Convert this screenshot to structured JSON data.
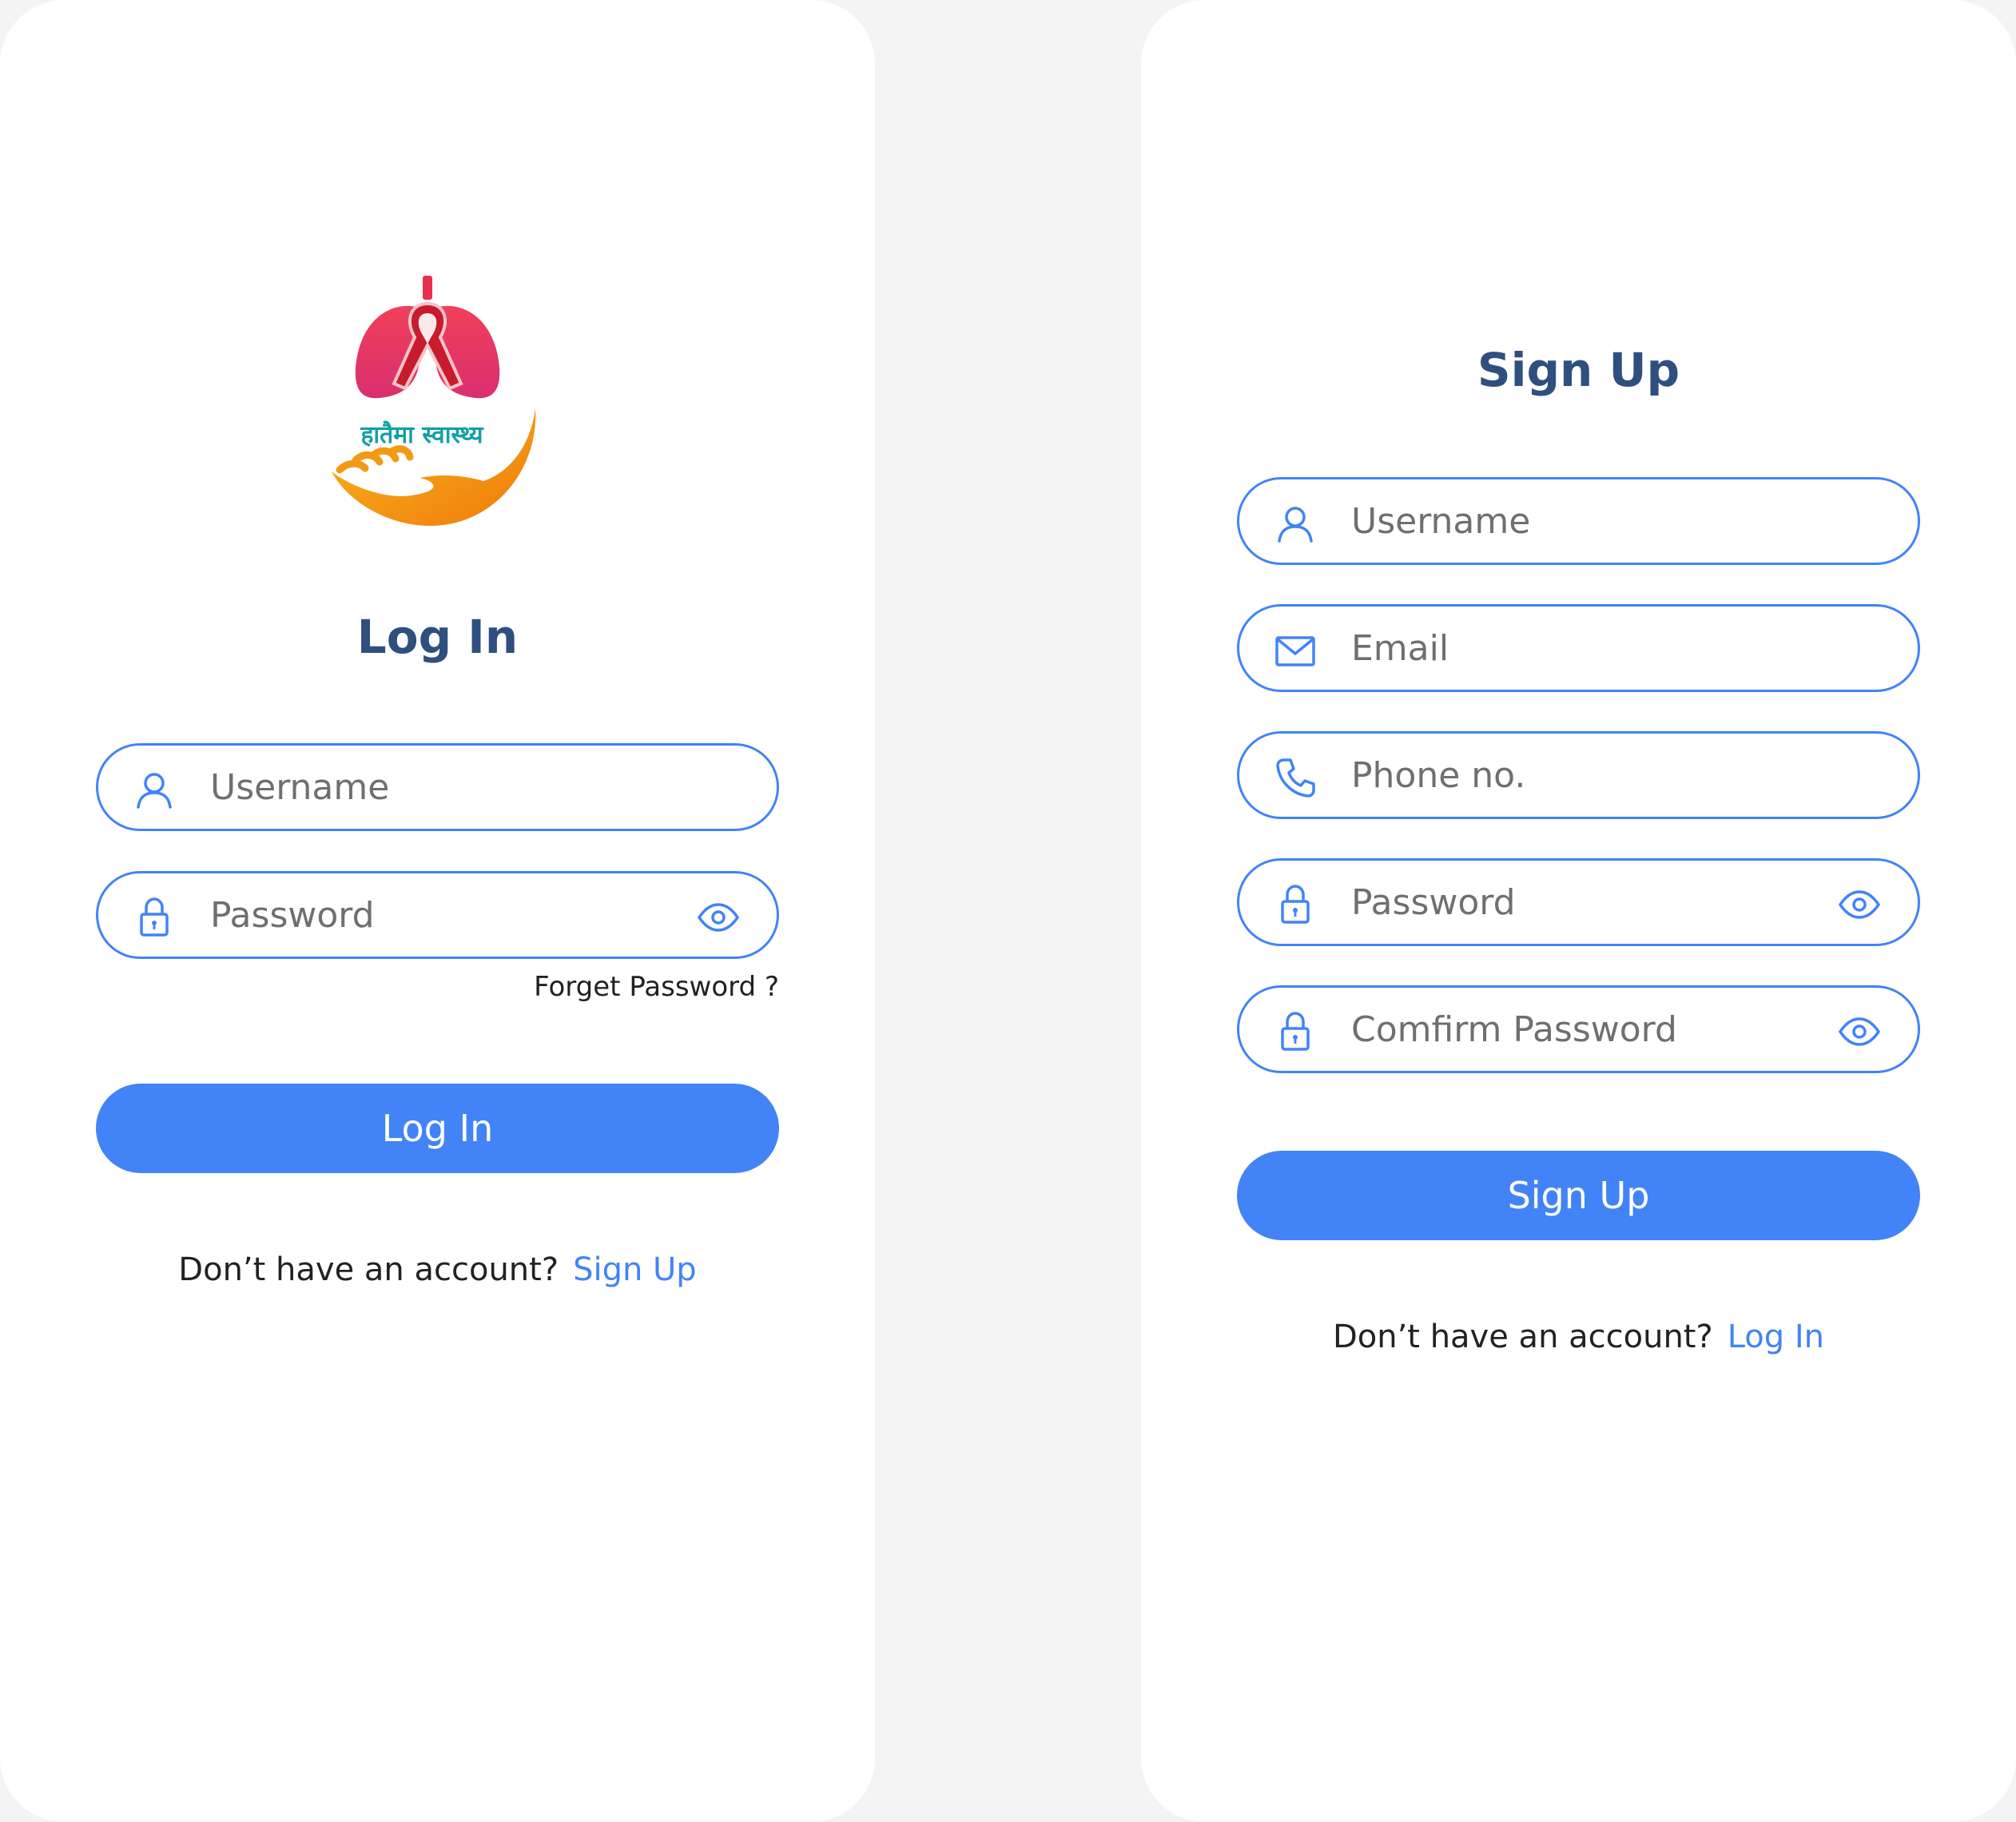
{
  "colors": {
    "accent": "#4283f7",
    "title": "#2f4f7f",
    "placeholder": "#6f6f6f",
    "card": "#ffffff",
    "background": "#f4f4f4"
  },
  "login": {
    "logo_text": "हातैमा स्वास्थ्य",
    "title": "Log In",
    "username": {
      "placeholder": "Username",
      "icon": "user-icon"
    },
    "password": {
      "placeholder": "Password",
      "icon": "lock-icon",
      "toggle_icon": "eye-icon"
    },
    "forgot_link": "Forget Password ?",
    "submit_label": "Log In",
    "switch_prompt": "Don’t have an account?",
    "switch_link": "Sign Up"
  },
  "signup": {
    "title": "Sign Up",
    "username": {
      "placeholder": "Username",
      "icon": "user-icon"
    },
    "email": {
      "placeholder": "Email",
      "icon": "mail-icon"
    },
    "phone": {
      "placeholder": "Phone no.",
      "icon": "phone-icon"
    },
    "password": {
      "placeholder": "Password",
      "icon": "lock-icon",
      "toggle_icon": "eye-icon"
    },
    "confirm_password": {
      "placeholder": "Comfirm Password",
      "icon": "lock-icon",
      "toggle_icon": "eye-icon"
    },
    "submit_label": "Sign Up",
    "switch_prompt": "Don’t have an account?",
    "switch_link": "Log In"
  }
}
